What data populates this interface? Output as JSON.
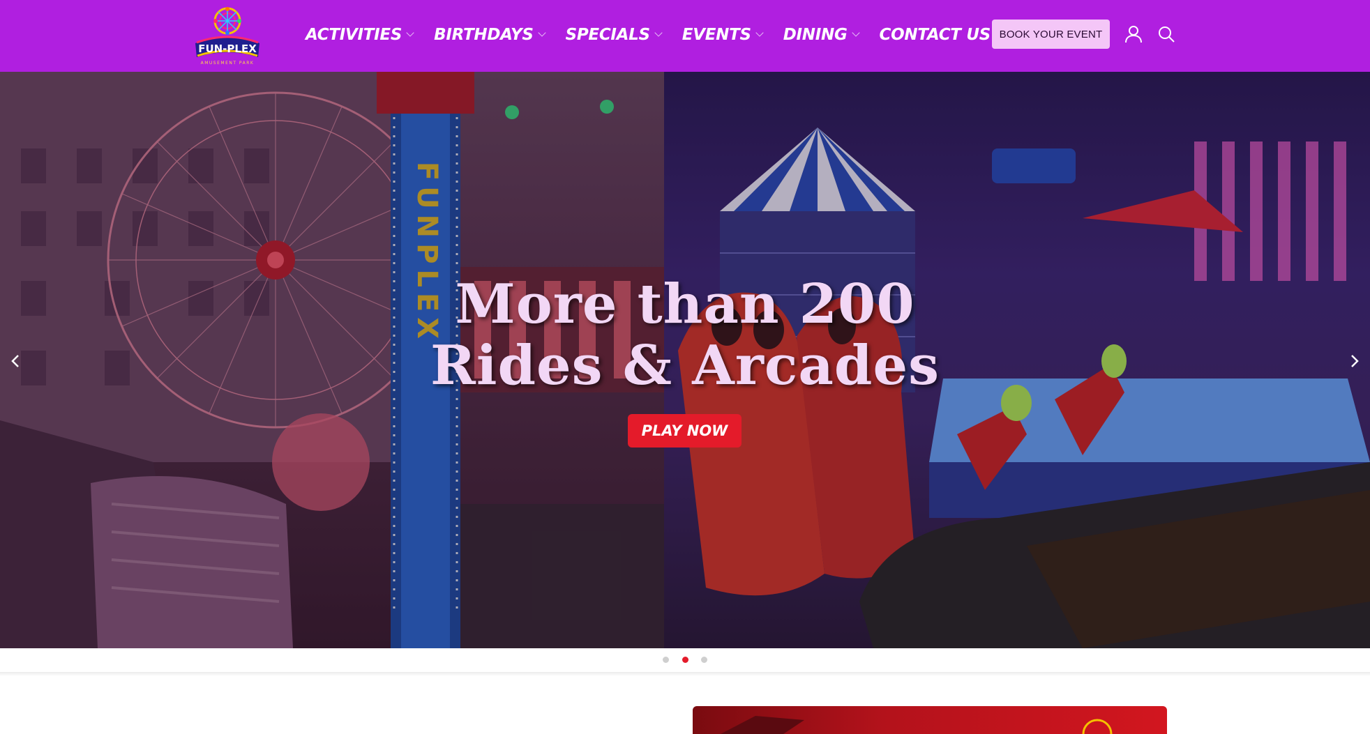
{
  "brand": {
    "logo_text": "FUN-PLEX",
    "logo_subtext": "AMUSEMENT PARK",
    "primary_color": "#b01fe0",
    "accent_color": "#e41b2a"
  },
  "nav": {
    "items": [
      {
        "label": "ACTIVITIES",
        "has_dropdown": true
      },
      {
        "label": "BIRTHDAYS",
        "has_dropdown": true
      },
      {
        "label": "SPECIALS",
        "has_dropdown": true
      },
      {
        "label": "EVENTS",
        "has_dropdown": true
      },
      {
        "label": "DINING",
        "has_dropdown": true
      },
      {
        "label": "CONTACT US",
        "has_dropdown": false
      }
    ],
    "book_label": "BOOK YOUR EVENT",
    "icons": [
      "user-icon",
      "search-icon"
    ]
  },
  "hero": {
    "title_line1": "More than 200",
    "title_line2": "Rides & Arcades",
    "cta_label": "PLAY NOW",
    "tower_text": "FUNPLEX",
    "slides_total": 3,
    "active_slide": 2
  }
}
